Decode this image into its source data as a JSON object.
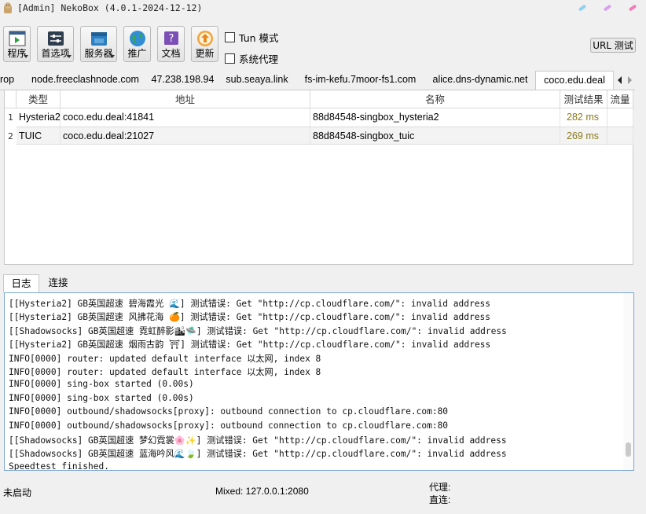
{
  "window": {
    "title": "[Admin] NekoBox (4.0.1-2024-12-12)"
  },
  "toolbar": {
    "program_label": "程序",
    "preferences_label": "首选项",
    "server_label": "服务器",
    "promote_label": "推广",
    "docs_label": "文档",
    "update_label": "更新"
  },
  "options": {
    "tun_label": "Tun 模式",
    "system_proxy_label": "系统代理"
  },
  "url_test_label": "URL 测试",
  "tabs": [
    {
      "label": "rop"
    },
    {
      "label": "node.freeclashnode.com"
    },
    {
      "label": "47.238.198.94"
    },
    {
      "label": "sub.seaya.link"
    },
    {
      "label": "fs-im-kefu.7moor-fs1.com"
    },
    {
      "label": "alice.dns-dynamic.net"
    },
    {
      "label": "coco.edu.deal"
    }
  ],
  "table": {
    "headers": {
      "type": "类型",
      "address": "地址",
      "name": "名称",
      "test": "测试结果",
      "traffic": "流量"
    },
    "rows": [
      {
        "num": "1",
        "type": "Hysteria2",
        "address": "coco.edu.deal:41841",
        "name": "88d84548-singbox_hysteria2",
        "latency": "282 ms"
      },
      {
        "num": "2",
        "type": "TUIC",
        "address": "coco.edu.deal:21027",
        "name": "88d84548-singbox_tuic",
        "latency": "269 ms"
      }
    ]
  },
  "log_tabs": {
    "log_label": "日志",
    "connections_label": "连接"
  },
  "log_lines": [
    "[[Hysteria2] GB英国超速 碧海霞光 🌊] 测试错误: Get \"http://cp.cloudflare.com/\": invalid address",
    "[[Hysteria2] GB英国超速 风拂花海 🍊] 测试错误: Get \"http://cp.cloudflare.com/\": invalid address",
    "[[Shadowsocks] GB英国超速 霓虹醉影🏙🛸] 测试错误: Get \"http://cp.cloudflare.com/\": invalid address",
    "[[Hysteria2] GB英国超速 烟雨古韵 ⛩] 测试错误: Get \"http://cp.cloudflare.com/\": invalid address",
    "INFO[0000] router: updated default interface 以太网, index 8",
    "INFO[0000] router: updated default interface 以太网, index 8",
    "INFO[0000] sing-box started (0.00s)",
    "INFO[0000] sing-box started (0.00s)",
    "INFO[0000] outbound/shadowsocks[proxy]: outbound connection to cp.cloudflare.com:80",
    "INFO[0000] outbound/shadowsocks[proxy]: outbound connection to cp.cloudflare.com:80",
    "[[Shadowsocks] GB英国超速 梦幻霓裳🌸✨] 测试错误: Get \"http://cp.cloudflare.com/\": invalid address",
    "[[Shadowsocks] GB英国超速 蓝海吟风🌊🍃] 测试错误: Get \"http://cp.cloudflare.com/\": invalid address",
    "Speedtest finished."
  ],
  "status": {
    "state": "未启动",
    "mixed": "Mixed: 127.0.0.1:2080",
    "proxy_label": "代理:",
    "direct_label": "直连:"
  },
  "colors": {
    "latency": "#8a7a1a",
    "log_border": "#7aa7d6"
  }
}
